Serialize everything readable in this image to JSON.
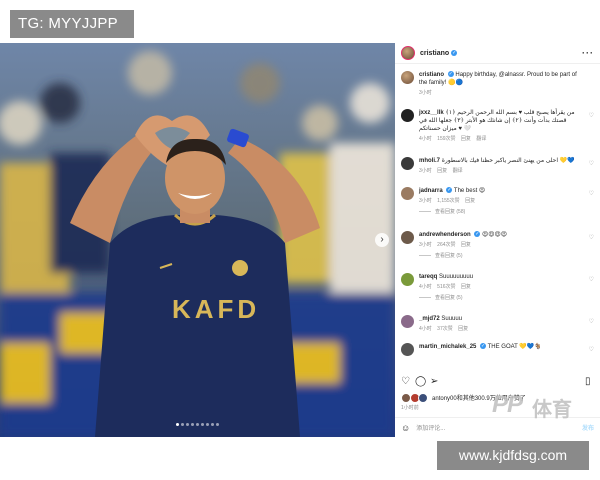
{
  "watermark_top": "TG: MYYJJPP",
  "watermark_bottom": "www.kjdfdsg.com",
  "watermark_brand": {
    "pp": "PP",
    "text": "体育"
  },
  "post": {
    "author": "cristiano",
    "more_label": "···",
    "jersey_text": "KAFD",
    "carousel": {
      "total": 9,
      "active": 1
    },
    "caption": {
      "user": "cristiano",
      "text": "Happy birthday, @alnassr. Proud to be part of the family! 🟡🔵",
      "time": "3小时"
    },
    "comments": [
      {
        "user": "jxxz__llk",
        "text": "من يقرأها يصبح قلب ♥ بسم الله الرحمن الرحيم ﴿١﴾ قصتك بدأت وأنت ﴿٢﴾ إن شانئك هو الأبتر ﴿٣﴾ جعلها الله في ميزان حسناتكم ♥ 🤍",
        "time": "4小时",
        "likes": "159次赞",
        "reply": "回复",
        "translate": "翻译",
        "replies": ""
      },
      {
        "user": "mholi.7",
        "text": "احلى من يهنئ النصر ياكبر حظنا فيك بالاسطورة 💛💙",
        "time": "3小时",
        "likes": "",
        "reply": "回复",
        "translate": "翻译",
        "replies": ""
      },
      {
        "user": "jadnarra",
        "text": "The best 😍",
        "time": "3小时",
        "likes": "1,155次赞",
        "reply": "回复",
        "translate": "",
        "replies": "查看回复 (58)"
      },
      {
        "user": "andrewhenderson",
        "text": "😍😍😍😍",
        "time": "3小时",
        "likes": "264次赞",
        "reply": "回复",
        "translate": "",
        "replies": "查看回复 (5)"
      },
      {
        "user": "tareqq",
        "text": "Suuuuuuuuu",
        "time": "4小时",
        "likes": "516次赞",
        "reply": "回复",
        "translate": "",
        "replies": "查看回复 (5)"
      },
      {
        "user": "_mjd72",
        "text": "Suuuuu",
        "time": "4小时",
        "likes": "37次赞",
        "reply": "回复",
        "translate": "",
        "replies": ""
      },
      {
        "user": "martin_michalek_25",
        "text": "THE GOAT 💛💙🐐",
        "time": "",
        "likes": "",
        "reply": "",
        "translate": "",
        "replies": ""
      }
    ],
    "liked_by": "antony00和其他300.9万位用户赞了",
    "date": "1小时前",
    "add_comment_placeholder": "添加评论...",
    "post_button": "发布",
    "icons": {
      "verified": "verified-icon",
      "heart": "heart-icon",
      "comment": "comment-icon",
      "share": "share-icon",
      "save": "bookmark-icon",
      "emoji": "emoji-icon",
      "next": "chevron-right-icon"
    }
  }
}
